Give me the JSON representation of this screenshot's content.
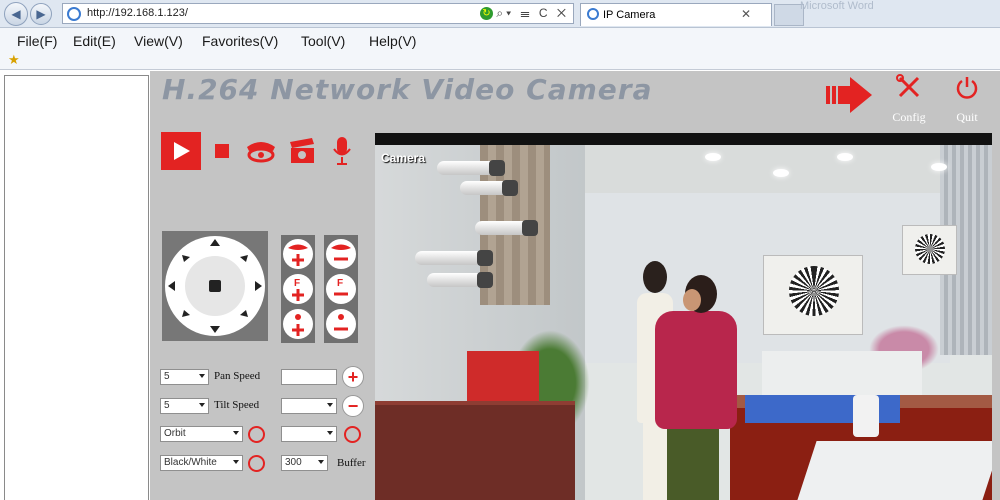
{
  "browser": {
    "url": "http://192.168.1.123/",
    "tab_title": "IP Camera",
    "ghost_tab": "Microsoft Word",
    "tab_close": "✕",
    "url_tools": "⌕▾ ☰ C ✕"
  },
  "menu": [
    {
      "label": "File(F)"
    },
    {
      "label": "Edit(E)"
    },
    {
      "label": "View(V)"
    },
    {
      "label": "Favorites(V)"
    },
    {
      "label": "Tool(V)"
    },
    {
      "label": "Help(V)"
    }
  ],
  "app": {
    "brand": "H.264 Network Video Camera",
    "config_label": "Config",
    "quit_label": "Quit",
    "accent": "#e32322"
  },
  "controls": {
    "icons": [
      "play-icon",
      "stop-icon",
      "record-icon",
      "snapshot-icon",
      "microphone-icon"
    ]
  },
  "zoom": {
    "col1": [
      "zoom-in",
      "focus-in",
      "brightness-up"
    ],
    "col2": [
      "zoom-out",
      "focus-out",
      "brightness-down"
    ]
  },
  "settings": {
    "pan_speed_value": "5",
    "pan_speed_label": "Pan Speed",
    "tilt_speed_value": "5",
    "tilt_speed_label": "Tilt Speed",
    "orbit_value": "Orbit",
    "mode_value": "Black/White",
    "buffer_value": "300",
    "buffer_label": "Buffer",
    "plus": "+",
    "minus": "−"
  },
  "video": {
    "osd": "Camera"
  }
}
